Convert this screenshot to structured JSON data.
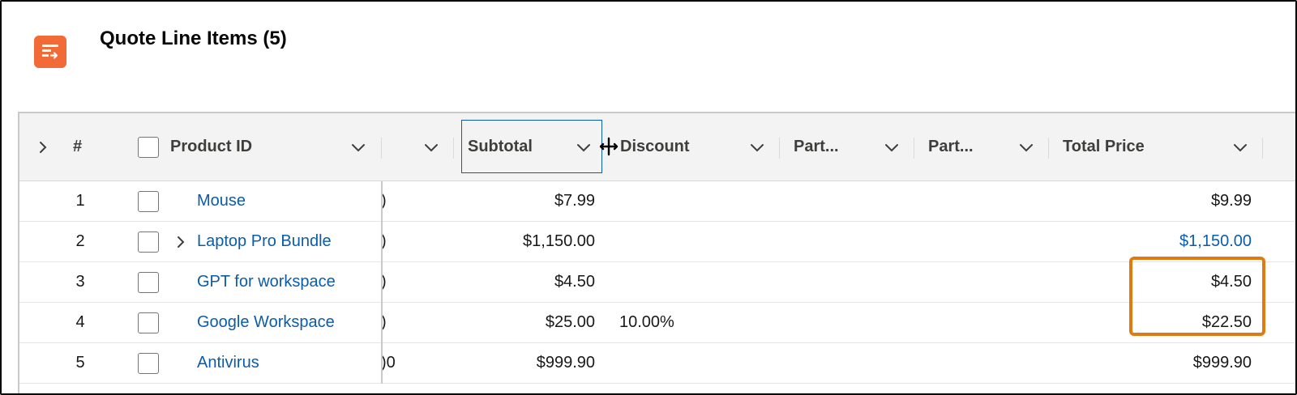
{
  "card": {
    "title": "Quote Line Items (5)",
    "icon": "quote-line-items-icon",
    "icon_color": "#f26a35"
  },
  "table": {
    "headers": {
      "row_num": "#",
      "product_id": "Product ID",
      "hidden_col": "",
      "subtotal": "Subtotal",
      "discount": "Discount",
      "part1": "Part...",
      "part2": "Part...",
      "total_price": "Total Price"
    },
    "rows": [
      {
        "num": "1",
        "product": "Mouse",
        "clip": ")",
        "subtotal": "$7.99",
        "discount": "",
        "total": "$9.99",
        "total_link": false,
        "expandable": false
      },
      {
        "num": "2",
        "product": "Laptop Pro Bundle",
        "clip": ")",
        "subtotal": "$1,150.00",
        "discount": "",
        "total": "$1,150.00",
        "total_link": true,
        "expandable": true
      },
      {
        "num": "3",
        "product": "GPT for workspace",
        "clip": ")",
        "subtotal": "$4.50",
        "discount": "",
        "total": "$4.50",
        "total_link": false,
        "expandable": false
      },
      {
        "num": "4",
        "product": "Google Workspace",
        "clip": ")",
        "subtotal": "$25.00",
        "discount": "10.00%",
        "total": "$22.50",
        "total_link": false,
        "expandable": false
      },
      {
        "num": "5",
        "product": "Antivirus",
        "clip": ")0",
        "subtotal": "$999.90",
        "discount": "",
        "total": "$999.90",
        "total_link": false,
        "expandable": false
      }
    ]
  },
  "colors": {
    "link": "#0b5cab",
    "highlight": "#e07b13",
    "header_bg": "#f3f3f3"
  }
}
